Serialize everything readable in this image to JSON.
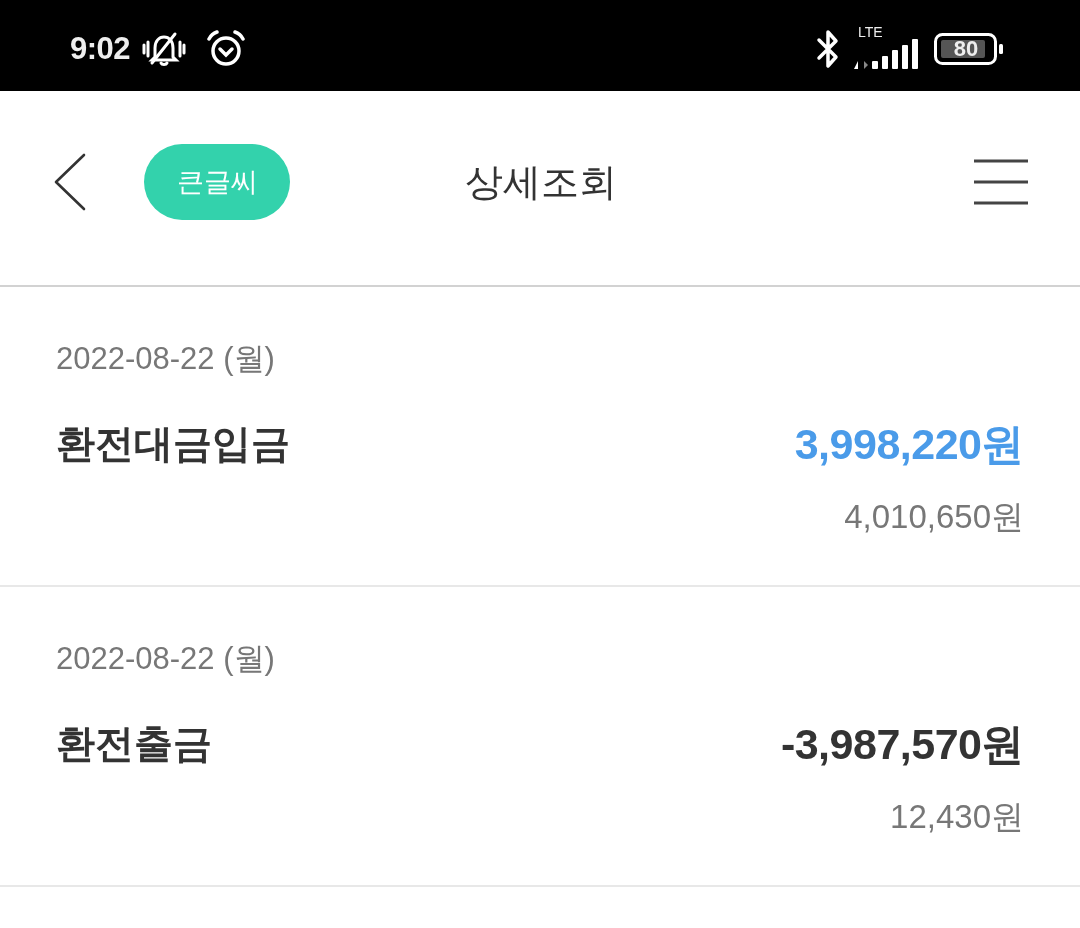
{
  "status_bar": {
    "time": "9:02",
    "network": "LTE",
    "battery": "80"
  },
  "header": {
    "large_text_button": "큰글씨",
    "title": "상세조회"
  },
  "transactions": [
    {
      "date": "2022-08-22 (월)",
      "description": "환전대금입금",
      "kind": "deposit",
      "amount": "3,998,220원",
      "balance": "4,010,650원"
    },
    {
      "date": "2022-08-22 (월)",
      "description": "환전출금",
      "kind": "withdrawal",
      "amount": "-3,987,570원",
      "balance": "12,430원"
    }
  ]
}
